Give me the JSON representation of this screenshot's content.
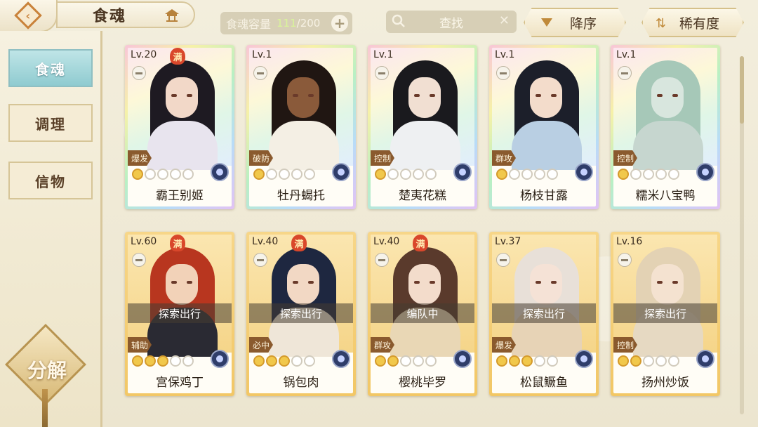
{
  "header": {
    "title": "食魂",
    "capacity_label": "食魂容量",
    "capacity_count": "111",
    "capacity_max": "/200",
    "search_label": "查找",
    "sort_label": "降序",
    "rarity_label": "稀有度"
  },
  "sidebar": {
    "tabs": [
      {
        "label": "食魂",
        "active": true
      },
      {
        "label": "调理",
        "active": false
      },
      {
        "label": "信物",
        "active": false
      }
    ],
    "decompose_label": "分解"
  },
  "cards": [
    {
      "frame": "rainbow",
      "level": "Lv.20",
      "max": true,
      "role": "爆发",
      "stars": 1,
      "name": "霸王别姬",
      "status": "",
      "palette": [
        "#1e1a22",
        "#f2d8c8",
        "#e8e4ee"
      ]
    },
    {
      "frame": "rainbow",
      "level": "Lv.1",
      "max": false,
      "role": "破防",
      "stars": 1,
      "name": "牡丹蝎托",
      "status": "",
      "palette": [
        "#201612",
        "#8a5a3a",
        "#f4efe4"
      ]
    },
    {
      "frame": "rainbow",
      "level": "Lv.1",
      "max": false,
      "role": "控制",
      "stars": 1,
      "name": "楚夷花糕",
      "status": "",
      "palette": [
        "#1a1a1e",
        "#f1dfd2",
        "#eef0f2"
      ]
    },
    {
      "frame": "rainbow",
      "level": "Lv.1",
      "max": false,
      "role": "群攻",
      "stars": 1,
      "name": "杨枝甘露",
      "status": "",
      "palette": [
        "#1c1f2a",
        "#f3dccb",
        "#b9cfe3"
      ]
    },
    {
      "frame": "rainbow",
      "level": "Lv.1",
      "max": false,
      "role": "控制",
      "stars": 1,
      "name": "糯米八宝鸭",
      "status": "",
      "palette": [
        "#a6c8b8",
        "#d8e6de",
        "#c6d6cf"
      ]
    },
    {
      "frame": "gold",
      "level": "Lv.60",
      "max": true,
      "role": "辅助",
      "stars": 3,
      "name": "宫保鸡丁",
      "status": "探索出行",
      "palette": [
        "#b8361f",
        "#f2d2b8",
        "#2a2a33"
      ]
    },
    {
      "frame": "gold",
      "level": "Lv.40",
      "max": true,
      "role": "必中",
      "stars": 3,
      "name": "锅包肉",
      "status": "探索出行",
      "palette": [
        "#1e2740",
        "#f2d8c4",
        "#efe6d8"
      ]
    },
    {
      "frame": "gold",
      "level": "Lv.40",
      "max": true,
      "role": "群攻",
      "stars": 2,
      "name": "樱桃毕罗",
      "status": "编队中",
      "palette": [
        "#5a3a2c",
        "#f3dccb",
        "#e9d7b5"
      ]
    },
    {
      "frame": "gold",
      "level": "Lv.37",
      "max": false,
      "role": "爆发",
      "stars": 3,
      "name": "松鼠鳜鱼",
      "status": "探索出行",
      "palette": [
        "#e8e0d8",
        "#f5e2d6",
        "#e7d3b6"
      ]
    },
    {
      "frame": "gold",
      "level": "Lv.16",
      "max": false,
      "role": "控制",
      "stars": 2,
      "name": "扬州炒饭",
      "status": "探索出行",
      "palette": [
        "#e3d2b4",
        "#f4e2d0",
        "#e6d9c2"
      ]
    }
  ],
  "max_badge_label": "满"
}
